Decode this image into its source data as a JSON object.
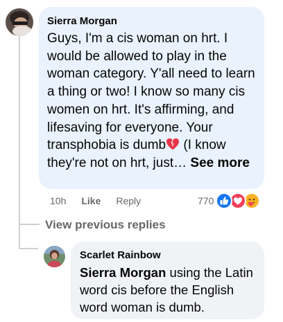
{
  "comment": {
    "author": "Sierra Morgan",
    "text_before_emoji": "Guys, I'm a cis woman on hrt. I would be allowed to play in the woman category. Y'all need to learn a thing or two! I know so many cis women on hrt. It's affirming, and lifesaving for everyone. Your transphobia is dumb",
    "emoji_icon": "mending-heart-icon",
    "text_after_emoji": " (I know they're not on hrt, just… ",
    "see_more": "See more",
    "timestamp": "10h",
    "like_label": "Like",
    "reply_label": "Reply",
    "reaction_count": "770",
    "reaction_icons": [
      "like-icon",
      "love-icon",
      "care-icon"
    ]
  },
  "view_previous_replies": "View previous replies",
  "reply": {
    "author": "Scarlet Rainbow",
    "mention": "Sierra Morgan",
    "text": " using the Latin word cis before the English word woman is dumb."
  },
  "colors": {
    "main_bubble": "#e9f2fd",
    "reply_bubble": "#f0f2f5",
    "meta_text": "#65676b",
    "like_blue": "#1877f2",
    "love_red": "#f33e58",
    "care_yellow": "#f7b125"
  }
}
